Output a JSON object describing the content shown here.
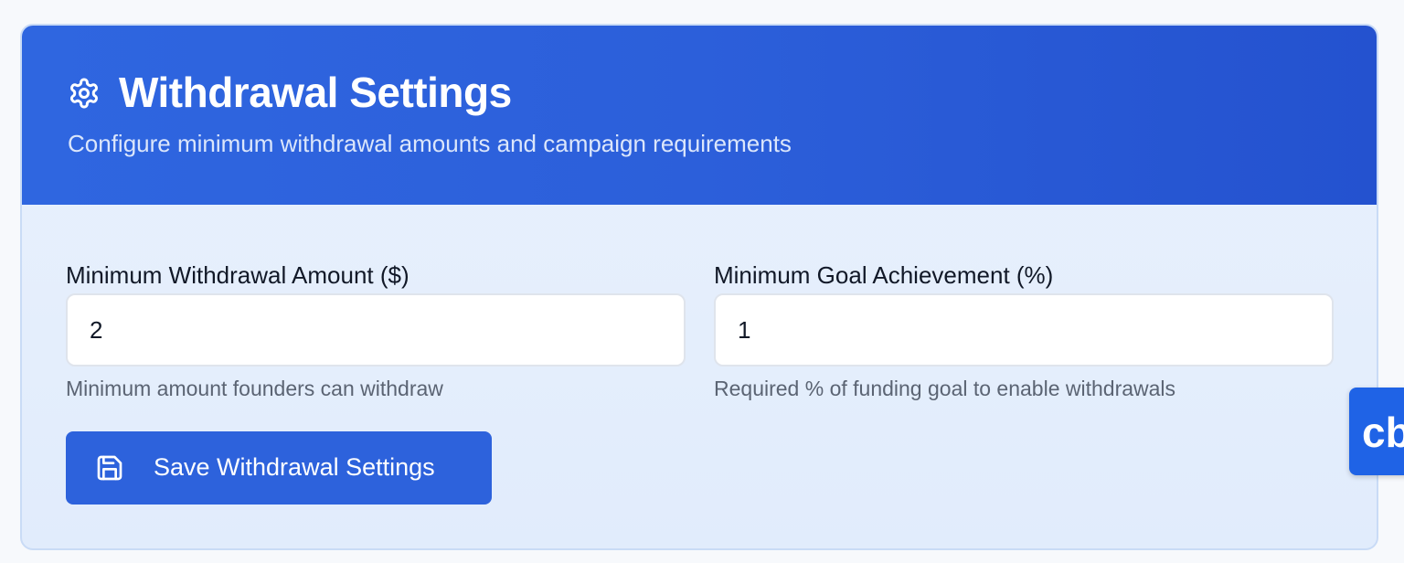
{
  "header": {
    "icon": "gear-icon",
    "title": "Withdrawal Settings",
    "subtitle": "Configure minimum withdrawal amounts and campaign requirements"
  },
  "fields": [
    {
      "label": "Minimum Withdrawal Amount ($)",
      "value": "2",
      "hint": "Minimum amount founders can withdraw"
    },
    {
      "label": "Minimum Goal Achievement (%)",
      "value": "1",
      "hint": "Required % of funding goal to enable withdrawals"
    }
  ],
  "save_button": {
    "icon": "save-icon",
    "label": "Save Withdrawal Settings"
  },
  "floating_widget": {
    "label": "cb"
  },
  "colors": {
    "header_bg": "#2c5fda",
    "button_bg": "#2d62dc",
    "body_bg": "#e5eefc",
    "floating_bg": "#1f63e6"
  }
}
